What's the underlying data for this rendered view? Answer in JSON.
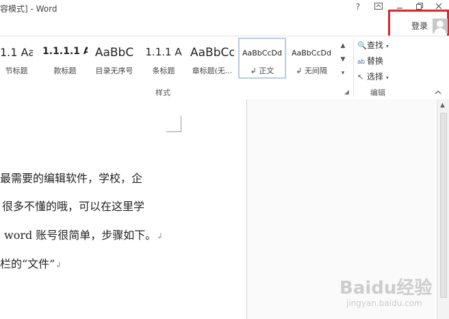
{
  "window": {
    "title": "容模式] - Word",
    "title_prefix_bracket": "[",
    "buttons": {
      "help": "?",
      "ribbon_display": "⬚",
      "minimize": "–",
      "restore": "🗗",
      "close": "✕"
    }
  },
  "account": {
    "signin_label": "登录",
    "avatar_icon": "user-avatar-icon",
    "highlight_color": "#d9252b"
  },
  "ribbon": {
    "styles": [
      {
        "sample": "1.1  Aa",
        "name": "节标题"
      },
      {
        "sample": "1.1.1.1  A",
        "name": "款标题"
      },
      {
        "sample": "AaBbC",
        "name": "目录无序号"
      },
      {
        "sample": "1.1.1  A",
        "name": "条标题"
      },
      {
        "sample": "AaBbCc",
        "name": "章标题(无..."
      },
      {
        "sample": "AaBbCcDd",
        "name": "↲ 正文"
      },
      {
        "sample": "AaBbCcDd",
        "name": "↲ 无间隔"
      }
    ],
    "styles_group_label": "样式",
    "editing": {
      "find": "查找",
      "replace": "替换",
      "select": "选择",
      "group_label": "编辑"
    }
  },
  "document": {
    "lines": [
      "最需要的编辑软件，学校，企",
      "很多不懂的哦，可以在这里学",
      "word 账号很简单，步骤如下。",
      "栏的“文件”"
    ],
    "paragraph_mark": "↲"
  },
  "watermark": {
    "main": "Baidu经验",
    "sub": "jingyan.baidu.com"
  }
}
